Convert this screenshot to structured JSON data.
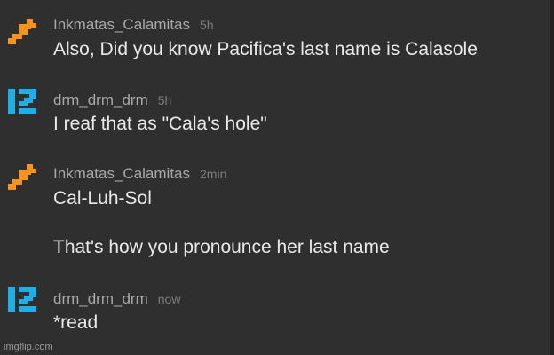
{
  "thread": {
    "comments": [
      {
        "username": "Inkmatas_Calamitas",
        "timestamp": "5h",
        "avatar_icon": "orange-pixel-worm-icon",
        "lines": [
          "Also, Did you know Pacifica's last name is Calasole"
        ]
      },
      {
        "username": "drm_drm_drm",
        "timestamp": "5h",
        "avatar_icon": "blue-pixel-letters-icon",
        "lines": [
          "I reaf that as \"Cala's hole\""
        ]
      },
      {
        "username": "Inkmatas_Calamitas",
        "timestamp": "2min",
        "avatar_icon": "orange-pixel-worm-icon",
        "lines": [
          "Cal-Luh-Sol",
          "That's how you pronounce her last name"
        ]
      },
      {
        "username": "drm_drm_drm",
        "timestamp": "now",
        "avatar_icon": "blue-pixel-letters-icon",
        "lines": [
          "*read"
        ]
      }
    ]
  },
  "watermark": "imgflip.com",
  "colors": {
    "background": "#2f2f2f",
    "username": "#a8a8a8",
    "timestamp": "#7c7c7c",
    "body_text": "#e9e9e9",
    "orange_avatar": "#f7941d",
    "blue_avatar": "#1eaee8"
  }
}
